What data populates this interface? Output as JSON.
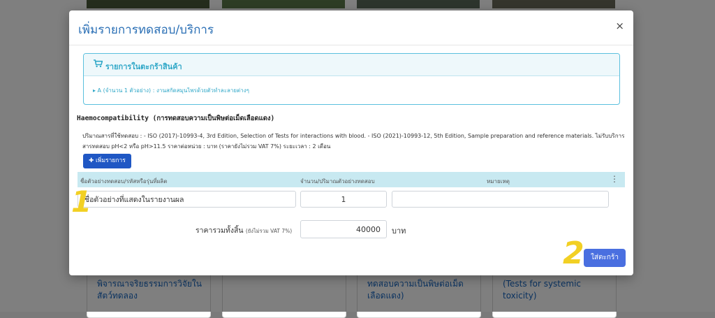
{
  "background": {
    "cards": [
      {
        "text": "พิจารณาจริยธรรมการวิจัยในสัตว์ทดลอง"
      },
      {
        "text": ""
      },
      {
        "text": "ทดสอบความเป็นพิษต่อเม็ดเลือดแดง)"
      },
      {
        "text": "(Tests for systemic toxicity)"
      }
    ]
  },
  "modal": {
    "title": "เพิ่มรายการทดสอบ/บริการ",
    "close_label": "×"
  },
  "cart": {
    "title": "รายการในตะกร้าสินค้า",
    "item": "▸ A (จำนวน 1 ตัวอย่าง) : งานสกัดสมุนไพรด้วยตัวทำละลายต่างๆ"
  },
  "test": {
    "title": "Haemocompatibility (การทดสอบความเป็นพิษต่อเม็ดเลือดแดง)",
    "description": "ปริมาณสารที่ใช้ทดสอบ : - ISO (2017)-10993-4, 3rd Edition, Selection of Tests for interactions with blood. - ISO (2021)-10993-12, 5th Edition, Sample preparation and reference materials. ไม่รับบริการสารทดสอบ pH<2 หรือ pH>11.5 ราคาต่อหน่วย : บาท (ราคายังไม่รวม VAT 7%) ระยะเวลา : 2 เดือน"
  },
  "add_button": {
    "icon": "plus-icon",
    "label": "✚ เพิ่มรายการ"
  },
  "table": {
    "headers": [
      "ชื่อตัวอย่างทดสอบ/รหัสหรือรุ่นที่ผลิต",
      "จำนวน/ปริมาณตัวอย่างทดสอบ",
      "หมายเหตุ"
    ],
    "menu_icon": "⋮",
    "row": {
      "name": "ชื่อตัวอย่างที่แสดงในรายงานผล",
      "quantity": "1",
      "note": ""
    }
  },
  "total": {
    "label": "ราคารวมทั้งสิ้น",
    "note": "(ยังไม่รวม VAT 7%)",
    "value": "40000",
    "currency": "บาท"
  },
  "submit_label": "ใส่ตะกร้า",
  "markers": [
    "1",
    "2"
  ],
  "colors": {
    "title": "#2a6fb5",
    "info": "#31a8c8",
    "primary": "#1f57c4",
    "submit": "#4a6fe0",
    "table_head": "#c8e9f1",
    "marker": "#f2d024"
  }
}
